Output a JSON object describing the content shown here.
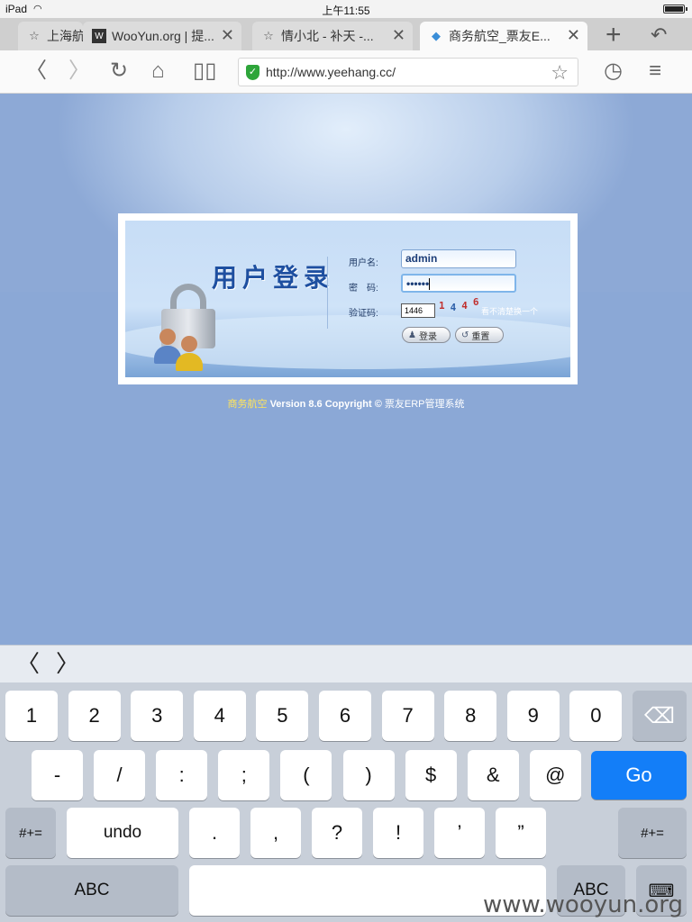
{
  "status_bar": {
    "device": "iPad",
    "time": "上午11:55"
  },
  "tabs": [
    {
      "label": "上海航",
      "icon": "star-icon"
    },
    {
      "label": "WooYun.org | 提...",
      "icon": "wooyun-icon"
    },
    {
      "label": "情小北 - 补天 -...",
      "icon": "star-icon"
    },
    {
      "label": "商务航空_票友E...",
      "icon": "site-icon"
    }
  ],
  "nav": {
    "url": "http://www.yeehang.cc/"
  },
  "login": {
    "title": "用户登录",
    "username_label": "用户名:",
    "username_value": "admin",
    "password_label": "密　码:",
    "password_value": "••••••",
    "captcha_label": "验证码:",
    "captcha_value": "1446",
    "captcha_image_text": [
      "1",
      "4",
      "4",
      "6"
    ],
    "refresh_text": "看不清楚换一个",
    "login_button": "登录",
    "reset_button": "重置"
  },
  "footer": {
    "brand": "商务航空",
    "version": "Version 8.6 Copyright ©",
    "system": "票友ERP管理系统"
  },
  "keyboard": {
    "row1": [
      "1",
      "2",
      "3",
      "4",
      "5",
      "6",
      "7",
      "8",
      "9",
      "0"
    ],
    "row2": [
      "-",
      "/",
      ":",
      ";",
      "(",
      ")",
      "$",
      "&",
      "@"
    ],
    "go": "Go",
    "row3_left": "#+=",
    "undo": "undo",
    "row3": [
      ".",
      ",",
      "?",
      "!",
      "’",
      "”"
    ],
    "row3_right": "#+=",
    "abc_left": "ABC",
    "abc_right": "ABC"
  },
  "watermark": "www.wooyun.org",
  "colors": {
    "go_key": "#137ef8",
    "page_bg": "#8ba8d6",
    "brand_yellow": "#ffe45c"
  }
}
